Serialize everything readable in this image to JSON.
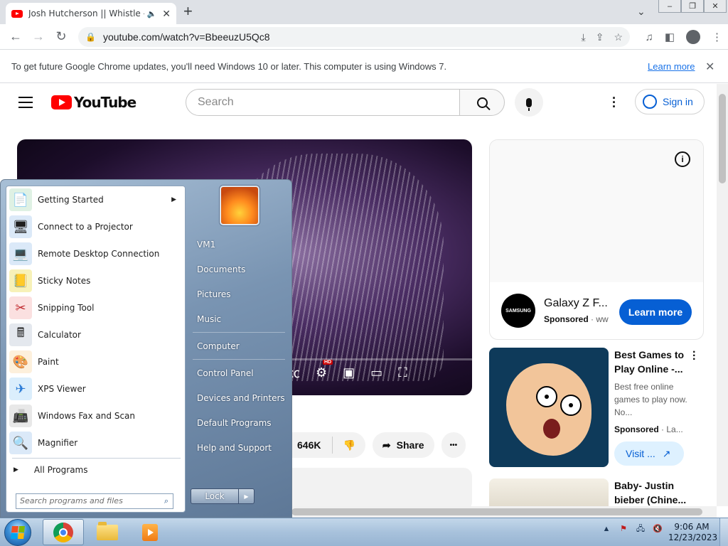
{
  "browser": {
    "tab_title": "Josh Hutcherson || Whistle -",
    "speaker_glyph": "🔈",
    "close_glyph": "✕",
    "newtab_glyph": "+",
    "url": "youtube.com/watch?v=BbeeuzU5Qc8",
    "win_min": "–",
    "win_restore": "❐",
    "win_close": "✕"
  },
  "infobar": {
    "message": "To get future Google Chrome updates, you'll need Windows 10 or later. This computer is using Windows 7.",
    "learn_more": "Learn more",
    "close_glyph": "✕"
  },
  "youtube": {
    "logo_text": "YouTube",
    "search_placeholder": "Search",
    "sign_in": "Sign in",
    "likes": "646K",
    "share": "Share",
    "more": "•••",
    "ad": {
      "brand_logo": "SAMSUNG",
      "title": "Galaxy Z F...",
      "sponsored": "Sponsored",
      "domain": "· ww",
      "cta": "Learn more",
      "info": "i"
    },
    "recommendations": [
      {
        "title": "Best Games to Play Online -...",
        "desc": "Best free online games to play now. No...",
        "sponsored": "Sponsored",
        "domain": "· La...",
        "cta": "Visit ..."
      },
      {
        "title": "Baby- Justin bieber (Chine..."
      }
    ]
  },
  "startmenu": {
    "programs": [
      {
        "label": "Getting Started",
        "icon": "getting-started-icon",
        "glyph": "📄",
        "has_arrow": true
      },
      {
        "label": "Connect to a Projector",
        "icon": "projector-icon",
        "glyph": "🖥"
      },
      {
        "label": "Remote Desktop Connection",
        "icon": "remote-desktop-icon",
        "glyph": "💻"
      },
      {
        "label": "Sticky Notes",
        "icon": "sticky-notes-icon",
        "glyph": "📒"
      },
      {
        "label": "Snipping Tool",
        "icon": "snipping-tool-icon",
        "glyph": "✂"
      },
      {
        "label": "Calculator",
        "icon": "calculator-icon",
        "glyph": "🖩"
      },
      {
        "label": "Paint",
        "icon": "paint-icon",
        "glyph": "🎨"
      },
      {
        "label": "XPS Viewer",
        "icon": "xps-viewer-icon",
        "glyph": "✈"
      },
      {
        "label": "Windows Fax and Scan",
        "icon": "fax-scan-icon",
        "glyph": "📠"
      },
      {
        "label": "Magnifier",
        "icon": "magnifier-icon",
        "glyph": "🔍"
      }
    ],
    "all_programs": "All Programs",
    "search_placeholder": "Search programs and files",
    "right_items": [
      "VM1",
      "Documents",
      "Pictures",
      "Music",
      "Computer",
      "Control Panel",
      "Devices and Printers",
      "Default Programs",
      "Help and Support"
    ],
    "lock": "Lock"
  },
  "taskbar": {
    "time": "9:06 AM",
    "date": "12/23/2023"
  },
  "colors": {
    "yt_red": "#ff0000",
    "yt_blue": "#065fd4",
    "chrome_link": "#1a73e8"
  }
}
